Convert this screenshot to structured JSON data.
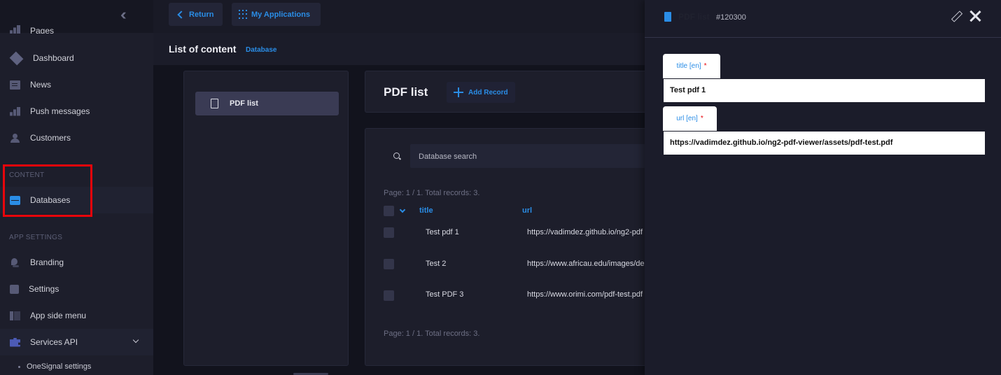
{
  "sidebar": {
    "top_item": "Pages",
    "items": [
      {
        "label": "Dashboard",
        "icon": "dashboard-icon"
      },
      {
        "label": "News",
        "icon": "news-icon"
      },
      {
        "label": "Push messages",
        "icon": "push-messages-icon"
      },
      {
        "label": "Customers",
        "icon": "customers-icon"
      }
    ],
    "content_section": "CONTENT",
    "databases": "Databases",
    "app_settings_section": "APP SETTINGS",
    "app_items": [
      {
        "label": "Branding",
        "icon": "branding-icon"
      },
      {
        "label": "Settings",
        "icon": "settings-icon"
      },
      {
        "label": "App side menu",
        "icon": "side-menu-icon"
      },
      {
        "label": "Services API",
        "icon": "puzzle-icon"
      }
    ],
    "sub_item": "OneSignal settings"
  },
  "topbar": {
    "return_label": "Return",
    "apps_label": "My Applications"
  },
  "location": {
    "title": "List of content",
    "badge": "Database"
  },
  "left_panel": {
    "item": "PDF list"
  },
  "list": {
    "title": "PDF list",
    "add_label": "Add Record",
    "search_placeholder": "Database search",
    "page_info_top": "Page: 1 / 1. Total records: 3.",
    "page_info_bottom": "Page: 1 / 1. Total records: 3.",
    "columns": [
      "title",
      "url"
    ],
    "rows": [
      {
        "title": "Test pdf 1",
        "url": "https://vadimdez.github.io/ng2-pdf"
      },
      {
        "title": "Test 2",
        "url": "https://www.africau.edu/images/de"
      },
      {
        "title": "Test PDF 3",
        "url": "https://www.orimi.com/pdf-test.pdf"
      }
    ]
  },
  "drawer": {
    "name": "PDF list",
    "record_id": "#120300",
    "fields": [
      {
        "label": "title [en]",
        "required": "*",
        "value": "Test pdf 1"
      },
      {
        "label": "url [en]",
        "required": "*",
        "value": "https://vadimdez.github.io/ng2-pdf-viewer/assets/pdf-test.pdf"
      }
    ]
  },
  "colors": {
    "accent": "#2a8de6",
    "highlight": "#e8050b",
    "background": "#191a26"
  }
}
